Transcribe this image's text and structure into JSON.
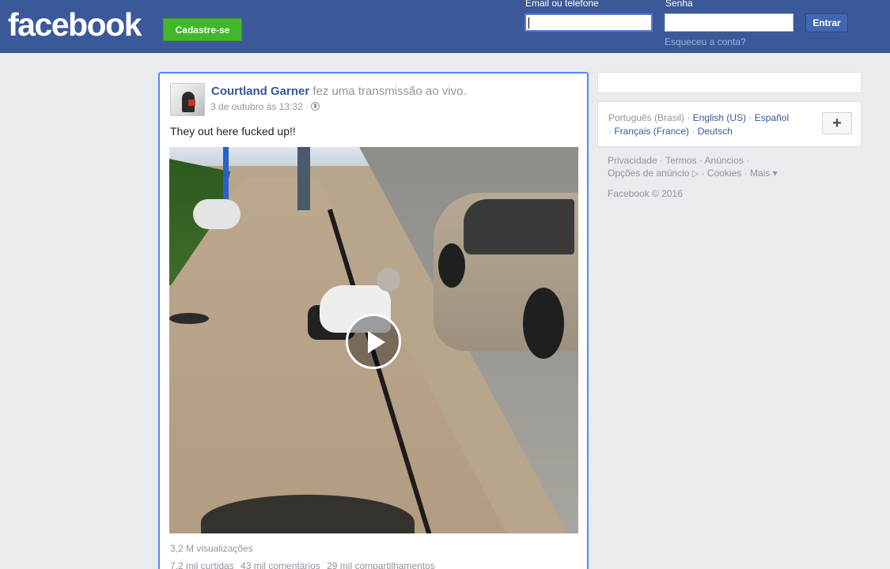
{
  "header": {
    "logo_text": "facebook",
    "signup_label": "Cadastre-se",
    "email_label": "Email ou telefone",
    "password_label": "Senha",
    "email_value": "",
    "password_value": "",
    "login_label": "Entrar",
    "forgot_label": "Esqueceu a conta?"
  },
  "post": {
    "author": "Courtland Garner",
    "action": "fez uma transmissão ao vivo.",
    "timestamp": "3 de outubro às 13:32",
    "separator": "·",
    "privacy_icon": "globe-icon",
    "text": "They out here fucked up!!",
    "video_icon": "play-icon",
    "views": "3,2 M visualizações",
    "likes": "7,2 mil curtidas",
    "comments": "43 mil comentários",
    "shares": "29 mil compartilhamentos"
  },
  "sidebar": {
    "languages": {
      "current": "Português (Brasil)",
      "links": [
        "English (US)",
        "Español",
        "Français (France)",
        "Deutsch"
      ],
      "add_label": "+"
    },
    "footer_links": [
      "Privacidade",
      "Termos",
      "Anúncios",
      "Opções de anúncio",
      "Cookies",
      "Mais"
    ],
    "more_arrow": "▾",
    "adchoices_icon": "▷",
    "copyright": "Facebook © 2016"
  },
  "colors": {
    "brand": "#3b5998",
    "signup": "#42b72a",
    "link": "#365899",
    "focus": "#4c8cf5"
  }
}
